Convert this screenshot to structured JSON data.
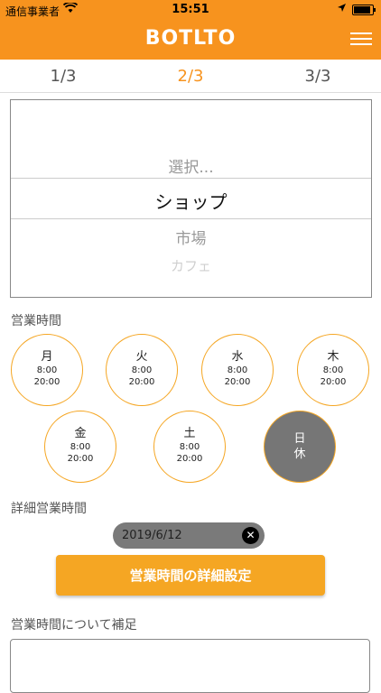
{
  "status_bar": {
    "carrier": "通信事業者",
    "time": "15:51",
    "battery_level": 0.9
  },
  "header": {
    "logo": "BOTLTO",
    "menu_icon": "hamburger-icon"
  },
  "steps": [
    {
      "label": "1/3",
      "active": false
    },
    {
      "label": "2/3",
      "active": true
    },
    {
      "label": "3/3",
      "active": false
    }
  ],
  "category_picker": {
    "options": [
      "選択...",
      "ショップ",
      "市場",
      "カフェ"
    ],
    "selected_index": 1
  },
  "business_hours": {
    "label": "営業時間",
    "days": [
      {
        "day": "月",
        "open": "8:00",
        "close": "20:00",
        "closed": false
      },
      {
        "day": "火",
        "open": "8:00",
        "close": "20:00",
        "closed": false
      },
      {
        "day": "水",
        "open": "8:00",
        "close": "20:00",
        "closed": false
      },
      {
        "day": "木",
        "open": "8:00",
        "close": "20:00",
        "closed": false
      },
      {
        "day": "金",
        "open": "8:00",
        "close": "20:00",
        "closed": false
      },
      {
        "day": "土",
        "open": "8:00",
        "close": "20:00",
        "closed": false
      },
      {
        "day": "日",
        "status": "休",
        "closed": true
      }
    ]
  },
  "detailed_hours": {
    "label": "詳細営業時間",
    "date_chip": "2019/6/12",
    "button_label": "営業時間の詳細設定"
  },
  "notes": {
    "label": "営業時間について補足",
    "value": ""
  },
  "colors": {
    "accent": "#f7931e",
    "button": "#f5a623",
    "closed_day": "#767676"
  }
}
